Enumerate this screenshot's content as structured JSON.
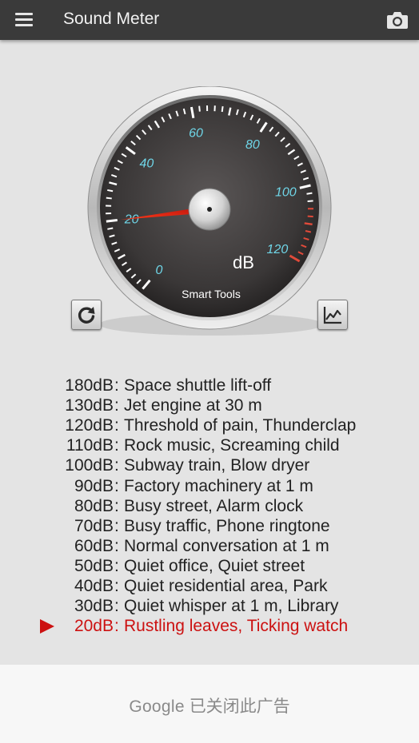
{
  "app": {
    "title": "Sound Meter"
  },
  "icons": {
    "menu": "menu-icon",
    "camera": "camera-icon",
    "refresh": "refresh-icon",
    "chart": "line-chart-icon"
  },
  "gauge": {
    "min": 0,
    "max": 120,
    "tick_labels": [
      "0",
      "20",
      "40",
      "60",
      "80",
      "100",
      "120"
    ],
    "unit": "dB",
    "brand": "Smart Tools",
    "needle_value": 20,
    "label_color": "#6fd6e8",
    "danger_color": "#e04a3a",
    "needle_color": "#e02a1a"
  },
  "reference": {
    "active_index": 12,
    "items": [
      {
        "db": "180dB",
        "desc": "Space shuttle lift-off"
      },
      {
        "db": "130dB",
        "desc": "Jet engine at 30 m"
      },
      {
        "db": "120dB",
        "desc": "Threshold of pain, Thunderclap"
      },
      {
        "db": "110dB",
        "desc": "Rock music, Screaming child"
      },
      {
        "db": "100dB",
        "desc": "Subway train, Blow dryer"
      },
      {
        "db": "90dB",
        "desc": "Factory machinery at 1 m"
      },
      {
        "db": "80dB",
        "desc": "Busy street, Alarm clock"
      },
      {
        "db": "70dB",
        "desc": "Busy traffic, Phone ringtone"
      },
      {
        "db": "60dB",
        "desc": "Normal conversation at 1 m"
      },
      {
        "db": "50dB",
        "desc": "Quiet office, Quiet street"
      },
      {
        "db": "40dB",
        "desc": "Quiet residential area, Park"
      },
      {
        "db": "30dB",
        "desc": "Quiet whisper at 1 m, Library"
      },
      {
        "db": "20dB",
        "desc": "Rustling leaves, Ticking watch"
      }
    ],
    "separator": ":",
    "active_color": "#cc1111"
  },
  "ad": {
    "brand": "Google",
    "text": "已关闭此广告"
  }
}
